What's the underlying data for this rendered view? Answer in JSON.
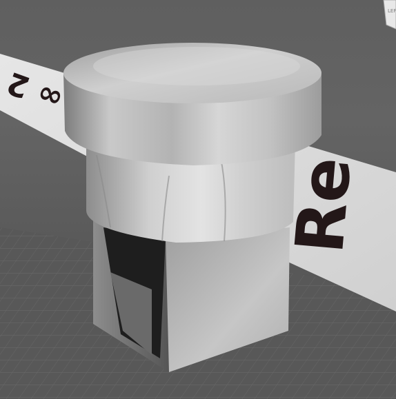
{
  "viewport": {
    "background_color": "#5f5f5f",
    "grid_color": "#727272"
  },
  "viewcube": {
    "face_label": "LEF"
  },
  "floor_strip": {
    "text_left": "∞ 2",
    "text_right": "Re"
  },
  "model": {
    "name": "cylinder-cap-on-box",
    "colors": {
      "light": "#d6d6d6",
      "mid": "#a9a9a9",
      "dark": "#2a2a2a"
    }
  }
}
